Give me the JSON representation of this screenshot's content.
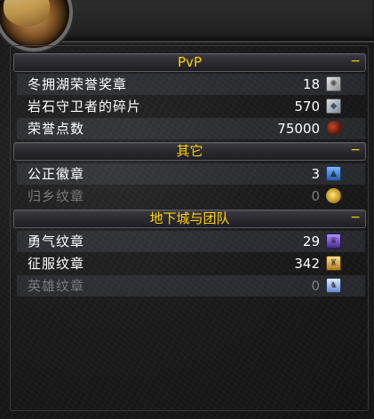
{
  "sections": [
    {
      "title": "PvP",
      "collapse_label": "−",
      "rows": [
        {
          "name": "冬拥湖荣誉奖章",
          "count": "18",
          "icon": "wintergrasp-mark-icon",
          "dim": false
        },
        {
          "name": "岩石守卫者的碎片",
          "count": "570",
          "icon": "stone-keeper-shard-icon",
          "dim": false
        },
        {
          "name": "荣誉点数",
          "count": "75000",
          "icon": "honor-points-icon",
          "dim": false
        }
      ]
    },
    {
      "title": "其它",
      "collapse_label": "−",
      "rows": [
        {
          "name": "公正徽章",
          "count": "3",
          "icon": "badge-of-justice-icon",
          "dim": false
        },
        {
          "name": "归乡纹章",
          "count": "0",
          "icon": "emblem-of-homecoming-icon",
          "dim": true
        }
      ]
    },
    {
      "title": "地下城与团队",
      "collapse_label": "−",
      "rows": [
        {
          "name": "勇气纹章",
          "count": "29",
          "icon": "emblem-of-valor-icon",
          "dim": false
        },
        {
          "name": "征服纹章",
          "count": "342",
          "icon": "emblem-of-conquest-icon",
          "dim": false
        },
        {
          "name": "英雄纹章",
          "count": "0",
          "icon": "emblem-of-heroism-icon",
          "dim": true
        }
      ]
    }
  ],
  "colors": {
    "header_text": "#ffd200",
    "row_text": "#ffffff",
    "dim_text": "#7a7a7a"
  }
}
